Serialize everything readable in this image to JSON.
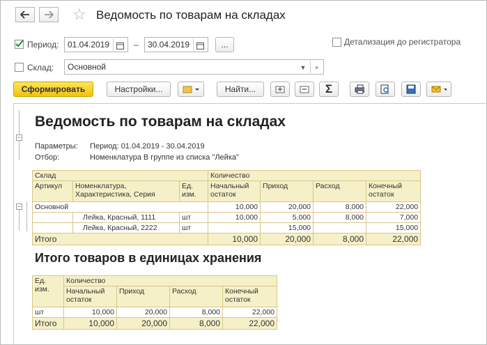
{
  "window": {
    "title": "Ведомость по товарам на складах"
  },
  "toolbar1": {
    "period_label": "Период:",
    "date_from": "01.04.2019",
    "date_sep": "–",
    "date_to": "30.04.2019",
    "more_label": "...",
    "detail_label": "Детализация до регистратора"
  },
  "toolbar2": {
    "warehouse_label": "Склад:",
    "warehouse_value": "Основной",
    "clear_label": "×"
  },
  "toolbar3": {
    "generate_label": "Сформировать",
    "settings_label": "Настройки...",
    "find_label": "Найти...",
    "sum_label": "Σ"
  },
  "report": {
    "title": "Ведомость по товарам на складах",
    "params_label": "Параметры:",
    "params_value": "Период: 01.04.2019 - 30.04.2019",
    "filter_label": "Отбор:",
    "filter_value": "Номенклатура В группе из списка \"Лейка\"",
    "table1": {
      "h_sklad": "Склад",
      "h_qty": "Количество",
      "h_article": "Артикул",
      "h_nom": "Номенклатура, Характеристика, Серия",
      "h_unit": "Ед. изм.",
      "h_start": "Начальный остаток",
      "h_in": "Приход",
      "h_out": "Расход",
      "h_end": "Конечный остаток",
      "group": {
        "name": "Основной",
        "start": "10,000",
        "in": "20,000",
        "out": "8,000",
        "end": "22,000"
      },
      "rows": [
        {
          "nom": "Лейка, Красный, 1111",
          "unit": "шт",
          "start": "10,000",
          "in": "5,000",
          "out": "8,000",
          "end": "7,000"
        },
        {
          "nom": "Лейка, Красный, 2222",
          "unit": "шт",
          "start": "",
          "in": "15,000",
          "out": "",
          "end": "15,000"
        }
      ],
      "total": {
        "label": "Итого",
        "start": "10,000",
        "in": "20,000",
        "out": "8,000",
        "end": "22,000"
      }
    },
    "title2": "Итого товаров в единицах хранения",
    "table2": {
      "h_unit": "Ед. изм.",
      "h_qty": "Количество",
      "h_start": "Начальный остаток",
      "h_in": "Приход",
      "h_out": "Расход",
      "h_end": "Конечный остаток",
      "row": {
        "unit": "шт",
        "start": "10,000",
        "in": "20,000",
        "out": "8,000",
        "end": "22,000"
      },
      "total": {
        "label": "Итого",
        "start": "10,000",
        "in": "20,000",
        "out": "8,000",
        "end": "22,000"
      }
    }
  }
}
